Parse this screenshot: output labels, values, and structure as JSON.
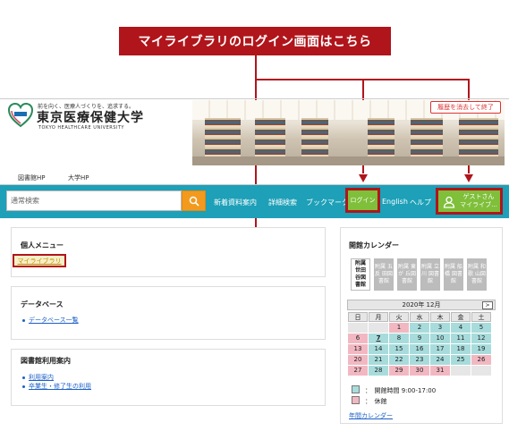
{
  "annotation": {
    "banner_text": "マイライブラリのログイン画面はこちら",
    "accent_color": "#b0151b"
  },
  "header": {
    "logo_tagline": "前を向く、医療人づくりを、追求する。",
    "logo_name": "東京医療保健大学",
    "logo_name_en": "TOKYO HEALTHCARE UNIVERSITY",
    "logout_label": "履歴を消去して終了"
  },
  "links": {
    "library_hp": "図書館HP",
    "university_hp": "大学HP"
  },
  "nav": {
    "search_placeholder": "通常検索",
    "new_arrivals": "新着資料案内",
    "advanced_search": "詳細検索",
    "bookmark": "ブックマーク",
    "login": "ログイン",
    "english": "English",
    "help": "ヘルプ",
    "guest_line1": "ゲストさん",
    "guest_line2": "マイライブ..."
  },
  "personal_menu": {
    "title": "個人メニュー",
    "my_library": "マイライブラリ"
  },
  "database": {
    "title": "データベース",
    "list_link": "データベース一覧"
  },
  "guide": {
    "title": "図書館利用案内",
    "items": [
      "利用案内",
      "卒業生・修了生の利用"
    ]
  },
  "calendar": {
    "title": "開館カレンダー",
    "library_tabs": [
      {
        "label": "附属 世田 谷図 書館",
        "active": true
      },
      {
        "label": "附属 五反 田図 書館",
        "active": false
      },
      {
        "label": "附属 東が 丘図 書館",
        "active": false
      },
      {
        "label": "附属 立川 図書 館",
        "active": false
      },
      {
        "label": "附属 船橋 図書 館",
        "active": false
      },
      {
        "label": "附属 和歌 山図 書館",
        "active": false
      }
    ],
    "month": "2020年 12月",
    "next_label": ">",
    "weekdays": [
      "日",
      "月",
      "火",
      "水",
      "木",
      "金",
      "土"
    ],
    "weeks": [
      [
        {
          "d": "",
          "s": "empty"
        },
        {
          "d": "",
          "s": "empty"
        },
        {
          "d": "1",
          "s": "closed"
        },
        {
          "d": "2",
          "s": "open"
        },
        {
          "d": "3",
          "s": "open"
        },
        {
          "d": "4",
          "s": "open"
        },
        {
          "d": "5",
          "s": "open"
        }
      ],
      [
        {
          "d": "6",
          "s": "closed"
        },
        {
          "d": "7",
          "s": "open",
          "today": true
        },
        {
          "d": "8",
          "s": "open"
        },
        {
          "d": "9",
          "s": "open"
        },
        {
          "d": "10",
          "s": "open"
        },
        {
          "d": "11",
          "s": "open"
        },
        {
          "d": "12",
          "s": "open"
        }
      ],
      [
        {
          "d": "13",
          "s": "closed"
        },
        {
          "d": "14",
          "s": "open"
        },
        {
          "d": "15",
          "s": "open"
        },
        {
          "d": "16",
          "s": "open"
        },
        {
          "d": "17",
          "s": "open"
        },
        {
          "d": "18",
          "s": "open"
        },
        {
          "d": "19",
          "s": "open"
        }
      ],
      [
        {
          "d": "20",
          "s": "closed"
        },
        {
          "d": "21",
          "s": "open"
        },
        {
          "d": "22",
          "s": "open"
        },
        {
          "d": "23",
          "s": "open"
        },
        {
          "d": "24",
          "s": "open"
        },
        {
          "d": "25",
          "s": "open"
        },
        {
          "d": "26",
          "s": "closed"
        }
      ],
      [
        {
          "d": "27",
          "s": "closed"
        },
        {
          "d": "28",
          "s": "open"
        },
        {
          "d": "29",
          "s": "closed"
        },
        {
          "d": "30",
          "s": "closed"
        },
        {
          "d": "31",
          "s": "closed"
        },
        {
          "d": "",
          "s": "empty"
        },
        {
          "d": "",
          "s": "empty"
        }
      ]
    ],
    "legend_open": "：　開館時間 9:00-17:00",
    "legend_closed": "：　休館",
    "annual_link": "年間カレンダー",
    "open_color": "#a8dcdc",
    "closed_color": "#f2b8c2"
  }
}
